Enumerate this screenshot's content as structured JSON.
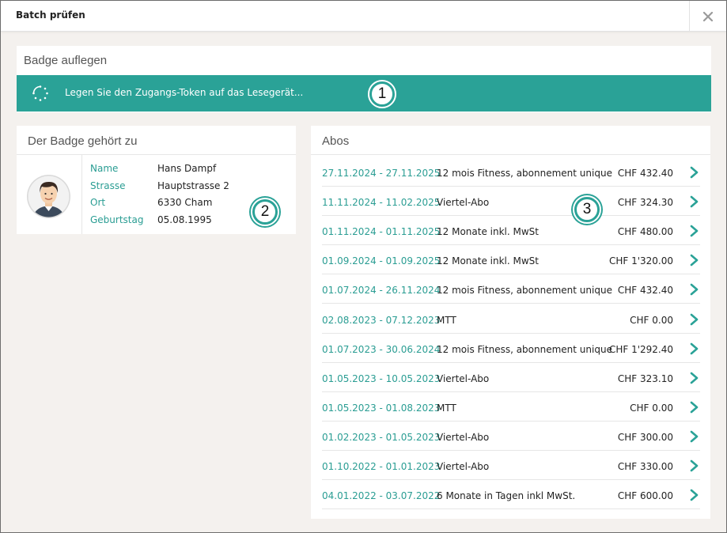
{
  "dialog": {
    "title": "Batch prüfen"
  },
  "badge_section": {
    "heading": "Badge auflegen",
    "token_message": "Legen Sie den Zugangs-Token auf das Lesegerät..."
  },
  "markers": [
    "1",
    "2",
    "3"
  ],
  "owner": {
    "heading": "Der Badge gehört zu",
    "fields": [
      {
        "label": "Name",
        "value": "Hans Dampf"
      },
      {
        "label": "Strasse",
        "value": "Hauptstrasse 2"
      },
      {
        "label": "Ort",
        "value": "6330 Cham"
      },
      {
        "label": "Geburtstag",
        "value": "05.08.1995"
      }
    ]
  },
  "abos": {
    "heading": "Abos",
    "items": [
      {
        "period": "27.11.2024 - 27.11.2025",
        "name": "12 mois Fitness, abonnement unique",
        "price": "CHF 432.40"
      },
      {
        "period": "11.11.2024 - 11.02.2025",
        "name": "Viertel-Abo",
        "price": "CHF 324.30"
      },
      {
        "period": "01.11.2024 - 01.11.2025",
        "name": "12 Monate inkl. MwSt",
        "price": "CHF 480.00"
      },
      {
        "period": "01.09.2024 - 01.09.2025",
        "name": "12 Monate inkl. MwSt",
        "price": "CHF 1'320.00"
      },
      {
        "period": "01.07.2024 - 26.11.2024",
        "name": "12 mois Fitness, abonnement unique",
        "price": "CHF 432.40"
      },
      {
        "period": "02.08.2023 - 07.12.2023",
        "name": "MTT",
        "price": "CHF 0.00"
      },
      {
        "period": "01.07.2023 - 30.06.2024",
        "name": "12 mois Fitness, abonnement unique",
        "price": "CHF 1'292.40"
      },
      {
        "period": "01.05.2023 - 10.05.2023",
        "name": "Viertel-Abo",
        "price": "CHF 323.10"
      },
      {
        "period": "01.05.2023 - 01.08.2023",
        "name": "MTT",
        "price": "CHF 0.00"
      },
      {
        "period": "01.02.2023 - 01.05.2023",
        "name": "Viertel-Abo",
        "price": "CHF 300.00"
      },
      {
        "period": "01.10.2022 - 01.01.2023",
        "name": "Viertel-Abo",
        "price": "CHF 330.00"
      },
      {
        "period": "04.01.2022 - 03.07.2022",
        "name": "6 Monate in Tagen inkl MwSt.",
        "price": "CHF 600.00"
      }
    ]
  },
  "colors": {
    "accent": "#2aa297",
    "accent_text": "#2a9d93",
    "background": "#f4f1ee"
  },
  "icons": {
    "close": "close-icon",
    "spinner": "loading-spinner-icon",
    "avatar": "user-avatar-icon",
    "chevron": "chevron-right-icon"
  }
}
